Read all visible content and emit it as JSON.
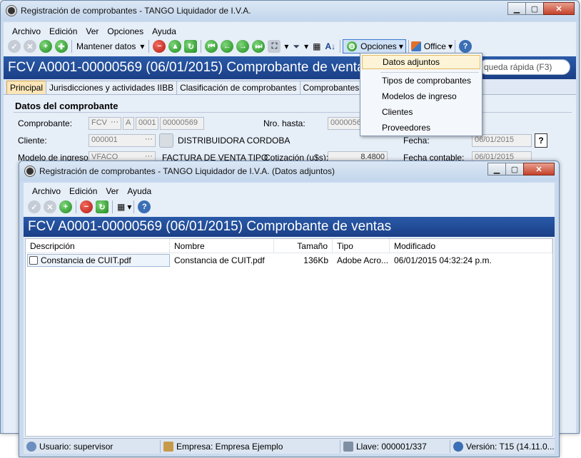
{
  "main_window": {
    "title": "Registración de comprobantes - TANGO Liquidador de I.V.A.",
    "menu": [
      "Archivo",
      "Edición",
      "Ver",
      "Opciones",
      "Ayuda"
    ],
    "toolbar": {
      "mantener_datos": "Mantener datos",
      "opciones": "Opciones",
      "office": "Office"
    },
    "banner": "FCV A0001-00000569  (06/01/2015)  Comprobante de ventas",
    "quick_search_placeholder": "Búsqueda rápida (F3)",
    "quick_search_visible": "queda rápida (F3)",
    "tabs": [
      "Principal",
      "Jurisdicciones y actividades IIBB",
      "Clasificación de comprobantes",
      "Comprobantes relaciona"
    ],
    "section_title": "Datos del comprobante",
    "labels": {
      "comprobante": "Comprobante:",
      "nro_hasta": "Nro. hasta:",
      "cliente": "Cliente:",
      "fecha": "Fecha:",
      "modelo": "Modelo de ingreso:",
      "cotizacion": "Cotización (u$s):",
      "fecha_contable": "Fecha contable:"
    },
    "fields": {
      "tipo": "FCV",
      "letra": "A",
      "pto_venta": "0001",
      "numero": "00000569",
      "nro_hasta": "0000056",
      "cliente_codigo": "000001",
      "cliente_nombre": "DISTRIBUIDORA CORDOBA",
      "fecha": "06/01/2015",
      "modelo_codigo": "VFACO",
      "modelo_nombre": "FACTURA DE VENTA TIPO",
      "cotizacion": "8.4800",
      "fecha_contable": "06/01/2015",
      "help": "?"
    },
    "dropdown": [
      "Datos adjuntos",
      "Tipos de comprobantes",
      "Modelos de ingreso",
      "Clientes",
      "Proveedores"
    ]
  },
  "child_window": {
    "title": "Registración de comprobantes - TANGO Liquidador de I.V.A. (Datos adjuntos)",
    "menu": [
      "Archivo",
      "Edición",
      "Ver",
      "Ayuda"
    ],
    "banner": "FCV A0001-00000569  (06/01/2015)  Comprobante de ventas",
    "columns": [
      "Descripción",
      "Nombre",
      "Tamaño",
      "Tipo",
      "Modificado"
    ],
    "rows": [
      {
        "descripcion": "Constancia de CUIT.pdf",
        "nombre": "Constancia de CUIT.pdf",
        "tamano": "136Kb",
        "tipo": "Adobe Acro...",
        "modificado": "06/01/2015 04:32:24 p.m."
      }
    ],
    "status": {
      "usuario": "Usuario: supervisor",
      "empresa": "Empresa: Empresa Ejemplo",
      "llave": "Llave: 000001/337",
      "version": "Versión: T15 (14.11.0..."
    }
  },
  "colors": {
    "banner": "#1f4a96",
    "accent_tab": "#fbe6b8",
    "highlight": "#fdf3d6"
  }
}
